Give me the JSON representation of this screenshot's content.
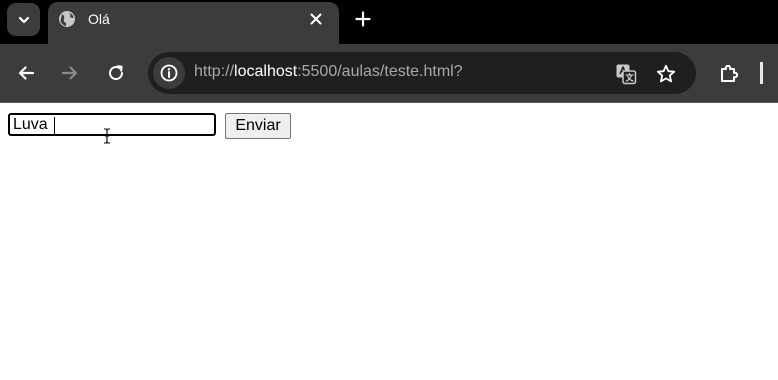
{
  "browser": {
    "tab": {
      "title": "Olá",
      "favicon_icon": "globe-icon",
      "close_icon": "close-icon"
    },
    "new_tab_icon": "plus-icon",
    "tab_search_icon": "chevron-down-icon",
    "nav": {
      "back_icon": "arrow-left-icon",
      "forward_icon": "arrow-right-icon",
      "reload_icon": "reload-icon"
    },
    "address_bar": {
      "site_info_icon": "info-icon",
      "url_scheme": "http://",
      "url_host": "localhost",
      "url_rest": ":5500/aulas/teste.html?",
      "translate_icon": "translate-icon",
      "bookmark_icon": "star-icon"
    },
    "extensions_icon": "puzzle-icon",
    "colors": {
      "tabbar_bg": "#000000",
      "toolbar_bg": "#3c3c3c",
      "omnibox_bg": "#1f1f1f"
    }
  },
  "page": {
    "form": {
      "input_value": "Luva ",
      "submit_label": "Enviar"
    }
  }
}
